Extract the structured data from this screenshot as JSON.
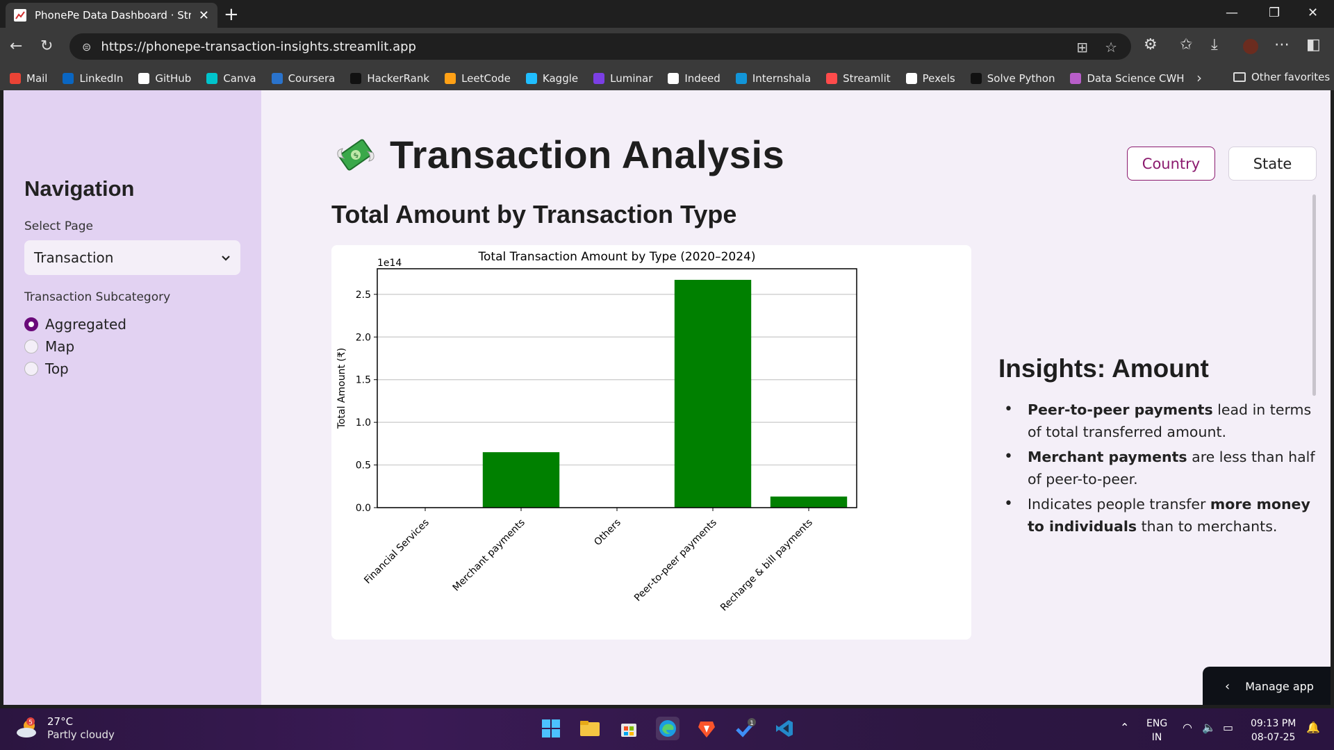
{
  "browser": {
    "tab_title": "PhonePe Data Dashboard · Streamlit",
    "url": "https://phonepe-transaction-insights.streamlit.app",
    "bookmarks": [
      {
        "label": "Mail",
        "icon": "gmail-icon",
        "color": "#ea4335"
      },
      {
        "label": "LinkedIn",
        "icon": "linkedin-icon",
        "color": "#0a66c2"
      },
      {
        "label": "GitHub",
        "icon": "github-icon",
        "color": "#ffffff"
      },
      {
        "label": "Canva",
        "icon": "canva-icon",
        "color": "#00c4cc"
      },
      {
        "label": "Coursera",
        "icon": "coursera-icon",
        "color": "#2a73cc"
      },
      {
        "label": "HackerRank",
        "icon": "hackerrank-icon",
        "color": "#111111"
      },
      {
        "label": "LeetCode",
        "icon": "leetcode-icon",
        "color": "#ffa116"
      },
      {
        "label": "Kaggle",
        "icon": "kaggle-icon",
        "color": "#20beff"
      },
      {
        "label": "Luminar",
        "icon": "luminar-icon",
        "color": "#7b3fe4"
      },
      {
        "label": "Indeed",
        "icon": "indeed-icon",
        "color": "#ffffff"
      },
      {
        "label": "Internshala",
        "icon": "internshala-icon",
        "color": "#1295d8"
      },
      {
        "label": "Streamlit",
        "icon": "streamlit-icon",
        "color": "#ff4b4b"
      },
      {
        "label": "Pexels",
        "icon": "pexels-icon",
        "color": "#ffffff"
      },
      {
        "label": "Solve Python",
        "icon": "hackerrank-icon",
        "color": "#111111"
      },
      {
        "label": "Data Science CWH",
        "icon": "cwh-icon",
        "color": "#b85ec9"
      }
    ],
    "other_favorites": "Other favorites"
  },
  "sidebar": {
    "title": "Navigation",
    "select_label": "Select Page",
    "select_value": "Transaction",
    "subcategory_label": "Transaction Subcategory",
    "options": [
      "Aggregated",
      "Map",
      "Top"
    ]
  },
  "main": {
    "title": "Transaction Analysis",
    "subtitle": "Total Amount by Transaction Type",
    "buttons": {
      "country": "Country",
      "state": "State"
    },
    "insights_title": "Insights: Amount"
  },
  "chart_data": {
    "type": "bar",
    "title": "Total Transaction Amount by Type (2020–2024)",
    "xlabel": "",
    "ylabel": "Total Amount (₹)",
    "scale_label": "1e14",
    "categories": [
      "Financial Services",
      "Merchant payments",
      "Others",
      "Peer-to-peer payments",
      "Recharge & bill payments"
    ],
    "values": [
      0.0002,
      0.65,
      0.0,
      2.67,
      0.13
    ],
    "ylim": [
      0,
      2.8
    ],
    "yticks": [
      "0.0",
      "0.5",
      "1.0",
      "1.5",
      "2.0",
      "2.5"
    ],
    "grid": true,
    "bar_color": "#008000"
  },
  "manage_app": "Manage app",
  "taskbar": {
    "temp": "27°C",
    "weather": "Partly cloudy",
    "weather_badge": "5",
    "lang1": "ENG",
    "lang2": "IN",
    "time": "09:13 PM",
    "date": "08-07-25",
    "badge": "1"
  }
}
